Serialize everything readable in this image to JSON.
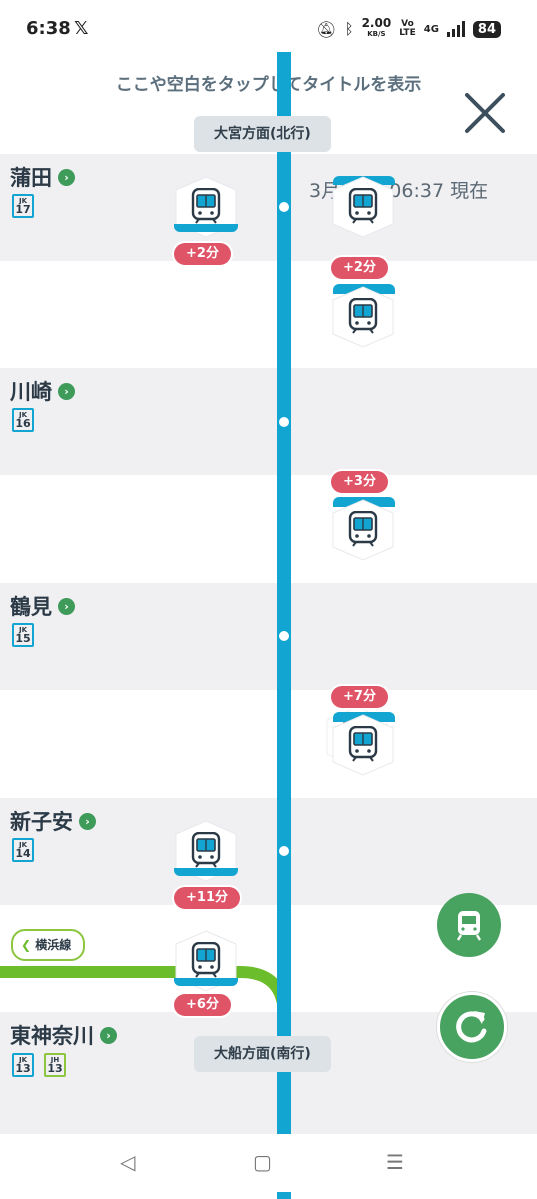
{
  "status_bar": {
    "time": "6:38",
    "x_icon": "x-logo-icon",
    "net_speed": "2.00",
    "net_unit": "KB/S",
    "volte_top": "Vo",
    "volte_bottom": "LTE",
    "network": "4G",
    "battery": "84"
  },
  "hint_text": "ここや空白をタップしてタイトルを表示",
  "timestamp": "3月30日 06:37 現在",
  "direction_north": "大宮方面(北行)",
  "direction_south": "大船方面(南行)",
  "stations": [
    {
      "name": "蒲田",
      "line": "JK",
      "number": "17"
    },
    {
      "name": "川崎",
      "line": "JK",
      "number": "16"
    },
    {
      "name": "鶴見",
      "line": "JK",
      "number": "15"
    },
    {
      "name": "新子安",
      "line": "JK",
      "number": "14"
    },
    {
      "name": "東神奈川",
      "line": "JK",
      "number": "13",
      "line2": "JH",
      "number2": "13"
    }
  ],
  "delays": [
    "+2分",
    "+2分",
    "+3分",
    "+7分",
    "+11分",
    "+6分"
  ],
  "transfer_line": "横浜線",
  "colors": {
    "line_keihin_tohoku": "#12a5d1",
    "line_yokohama": "#8cc63f",
    "delay": "#e05468",
    "fab": "#48a260"
  }
}
